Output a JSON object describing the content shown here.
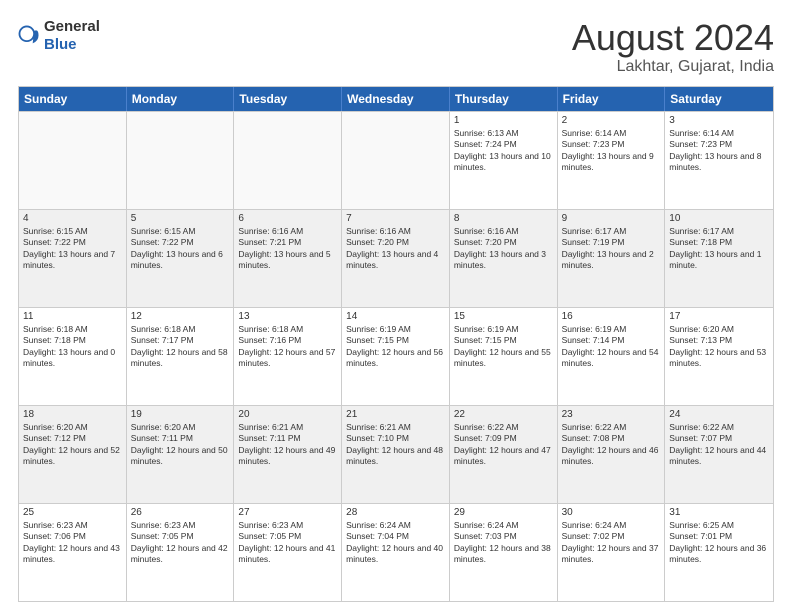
{
  "header": {
    "logo_general": "General",
    "logo_blue": "Blue",
    "main_title": "August 2024",
    "subtitle": "Lakhtar, Gujarat, India"
  },
  "weekdays": [
    "Sunday",
    "Monday",
    "Tuesday",
    "Wednesday",
    "Thursday",
    "Friday",
    "Saturday"
  ],
  "rows": [
    [
      {
        "day": "",
        "empty": true
      },
      {
        "day": "",
        "empty": true
      },
      {
        "day": "",
        "empty": true
      },
      {
        "day": "",
        "empty": true
      },
      {
        "day": "1",
        "sunrise": "6:13 AM",
        "sunset": "7:24 PM",
        "daylight": "13 hours and 10 minutes."
      },
      {
        "day": "2",
        "sunrise": "6:14 AM",
        "sunset": "7:23 PM",
        "daylight": "13 hours and 9 minutes."
      },
      {
        "day": "3",
        "sunrise": "6:14 AM",
        "sunset": "7:23 PM",
        "daylight": "13 hours and 8 minutes."
      }
    ],
    [
      {
        "day": "4",
        "sunrise": "6:15 AM",
        "sunset": "7:22 PM",
        "daylight": "13 hours and 7 minutes."
      },
      {
        "day": "5",
        "sunrise": "6:15 AM",
        "sunset": "7:22 PM",
        "daylight": "13 hours and 6 minutes."
      },
      {
        "day": "6",
        "sunrise": "6:16 AM",
        "sunset": "7:21 PM",
        "daylight": "13 hours and 5 minutes."
      },
      {
        "day": "7",
        "sunrise": "6:16 AM",
        "sunset": "7:20 PM",
        "daylight": "13 hours and 4 minutes."
      },
      {
        "day": "8",
        "sunrise": "6:16 AM",
        "sunset": "7:20 PM",
        "daylight": "13 hours and 3 minutes."
      },
      {
        "day": "9",
        "sunrise": "6:17 AM",
        "sunset": "7:19 PM",
        "daylight": "13 hours and 2 minutes."
      },
      {
        "day": "10",
        "sunrise": "6:17 AM",
        "sunset": "7:18 PM",
        "daylight": "13 hours and 1 minute."
      }
    ],
    [
      {
        "day": "11",
        "sunrise": "6:18 AM",
        "sunset": "7:18 PM",
        "daylight": "13 hours and 0 minutes."
      },
      {
        "day": "12",
        "sunrise": "6:18 AM",
        "sunset": "7:17 PM",
        "daylight": "12 hours and 58 minutes."
      },
      {
        "day": "13",
        "sunrise": "6:18 AM",
        "sunset": "7:16 PM",
        "daylight": "12 hours and 57 minutes."
      },
      {
        "day": "14",
        "sunrise": "6:19 AM",
        "sunset": "7:15 PM",
        "daylight": "12 hours and 56 minutes."
      },
      {
        "day": "15",
        "sunrise": "6:19 AM",
        "sunset": "7:15 PM",
        "daylight": "12 hours and 55 minutes."
      },
      {
        "day": "16",
        "sunrise": "6:19 AM",
        "sunset": "7:14 PM",
        "daylight": "12 hours and 54 minutes."
      },
      {
        "day": "17",
        "sunrise": "6:20 AM",
        "sunset": "7:13 PM",
        "daylight": "12 hours and 53 minutes."
      }
    ],
    [
      {
        "day": "18",
        "sunrise": "6:20 AM",
        "sunset": "7:12 PM",
        "daylight": "12 hours and 52 minutes."
      },
      {
        "day": "19",
        "sunrise": "6:20 AM",
        "sunset": "7:11 PM",
        "daylight": "12 hours and 50 minutes."
      },
      {
        "day": "20",
        "sunrise": "6:21 AM",
        "sunset": "7:11 PM",
        "daylight": "12 hours and 49 minutes."
      },
      {
        "day": "21",
        "sunrise": "6:21 AM",
        "sunset": "7:10 PM",
        "daylight": "12 hours and 48 minutes."
      },
      {
        "day": "22",
        "sunrise": "6:22 AM",
        "sunset": "7:09 PM",
        "daylight": "12 hours and 47 minutes."
      },
      {
        "day": "23",
        "sunrise": "6:22 AM",
        "sunset": "7:08 PM",
        "daylight": "12 hours and 46 minutes."
      },
      {
        "day": "24",
        "sunrise": "6:22 AM",
        "sunset": "7:07 PM",
        "daylight": "12 hours and 44 minutes."
      }
    ],
    [
      {
        "day": "25",
        "sunrise": "6:23 AM",
        "sunset": "7:06 PM",
        "daylight": "12 hours and 43 minutes."
      },
      {
        "day": "26",
        "sunrise": "6:23 AM",
        "sunset": "7:05 PM",
        "daylight": "12 hours and 42 minutes."
      },
      {
        "day": "27",
        "sunrise": "6:23 AM",
        "sunset": "7:05 PM",
        "daylight": "12 hours and 41 minutes."
      },
      {
        "day": "28",
        "sunrise": "6:24 AM",
        "sunset": "7:04 PM",
        "daylight": "12 hours and 40 minutes."
      },
      {
        "day": "29",
        "sunrise": "6:24 AM",
        "sunset": "7:03 PM",
        "daylight": "12 hours and 38 minutes."
      },
      {
        "day": "30",
        "sunrise": "6:24 AM",
        "sunset": "7:02 PM",
        "daylight": "12 hours and 37 minutes."
      },
      {
        "day": "31",
        "sunrise": "6:25 AM",
        "sunset": "7:01 PM",
        "daylight": "12 hours and 36 minutes."
      }
    ]
  ]
}
